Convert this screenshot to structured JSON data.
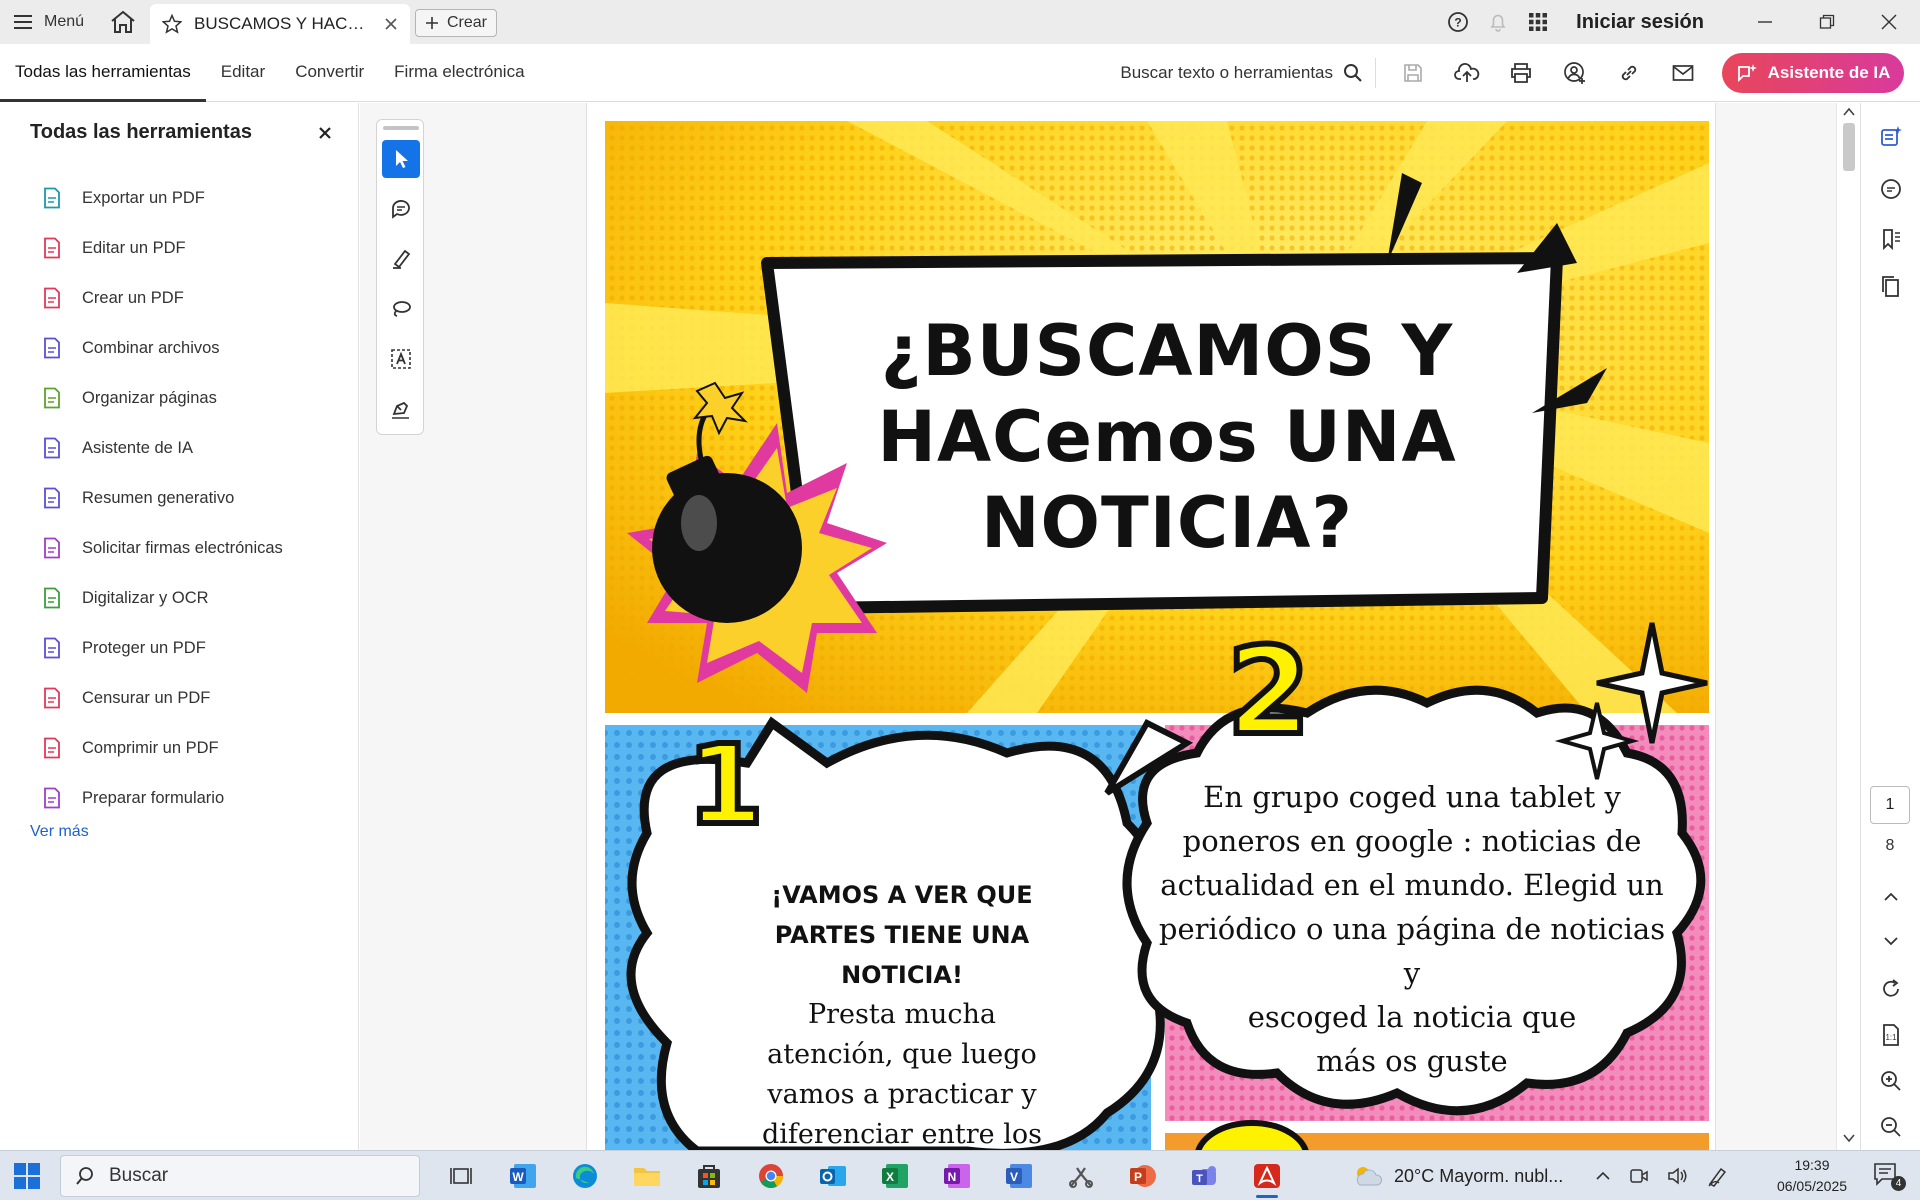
{
  "titlebar": {
    "menu_label": "Menú",
    "tab_title": "BUSCAMOS Y HACEMOS UNA NOTICIA",
    "create_label": "Crear",
    "signin_label": "Iniciar sesión"
  },
  "toolbar": {
    "tabs": [
      "Todas las herramientas",
      "Editar",
      "Convertir",
      "Firma electrónica"
    ],
    "search_label": "Buscar texto o herramientas",
    "ai_button_label": "Asistente de IA"
  },
  "left_panel": {
    "title": "Todas las herramientas",
    "items": [
      {
        "label": "Exportar un PDF",
        "icon": "export-pdf-icon",
        "color": "#1a9aa8"
      },
      {
        "label": "Editar un PDF",
        "icon": "edit-pdf-icon",
        "color": "#e0395a"
      },
      {
        "label": "Crear un PDF",
        "icon": "create-pdf-icon",
        "color": "#e0395a"
      },
      {
        "label": "Combinar archivos",
        "icon": "combine-files-icon",
        "color": "#5b4fd9"
      },
      {
        "label": "Organizar páginas",
        "icon": "organize-pages-icon",
        "color": "#5aa32c"
      },
      {
        "label": "Asistente de IA",
        "icon": "ai-assistant-icon",
        "color": "#5b4fd9"
      },
      {
        "label": "Resumen generativo",
        "icon": "generative-summary-icon",
        "color": "#5b4fd9"
      },
      {
        "label": "Solicitar firmas electrónicas",
        "icon": "request-signatures-icon",
        "color": "#a03ec4"
      },
      {
        "label": "Digitalizar y OCR",
        "icon": "scan-ocr-icon",
        "color": "#3b9e3b"
      },
      {
        "label": "Proteger un PDF",
        "icon": "protect-pdf-icon",
        "color": "#5b4fd9"
      },
      {
        "label": "Censurar un PDF",
        "icon": "redact-pdf-icon",
        "color": "#e0395a"
      },
      {
        "label": "Comprimir un PDF",
        "icon": "compress-pdf-icon",
        "color": "#e0395a"
      },
      {
        "label": "Preparar formulario",
        "icon": "prepare-form-icon",
        "color": "#a03ec4"
      }
    ],
    "more_label": "Ver más"
  },
  "document": {
    "heading_lines": [
      "¿BUSCAMOS Y",
      "HACemos UNA",
      "NOTICIA?"
    ],
    "bubble1_number": "1",
    "bubble1_title_lines": [
      "¡VAMOS A VER QUE",
      "PARTES TIENE UNA",
      "NOTICIA!"
    ],
    "bubble1_body_lines": [
      "Presta mucha",
      "atención, que luego",
      "vamos a practicar y",
      "diferenciar entre los"
    ],
    "bubble2_number": "2",
    "bubble2_lines": [
      "En grupo coged una tablet y",
      "poneros en google : noticias de",
      "actualidad en el mundo. Elegid un",
      "periódico o una página de noticias y",
      "escoged la noticia que",
      "más os guste"
    ]
  },
  "page_nav": {
    "current": "1",
    "total": "8"
  },
  "taskbar": {
    "search_placeholder": "Buscar",
    "weather": "20°C  Mayorm. nubl...",
    "time": "19:39",
    "date": "06/05/2025",
    "notification_count": "4"
  }
}
